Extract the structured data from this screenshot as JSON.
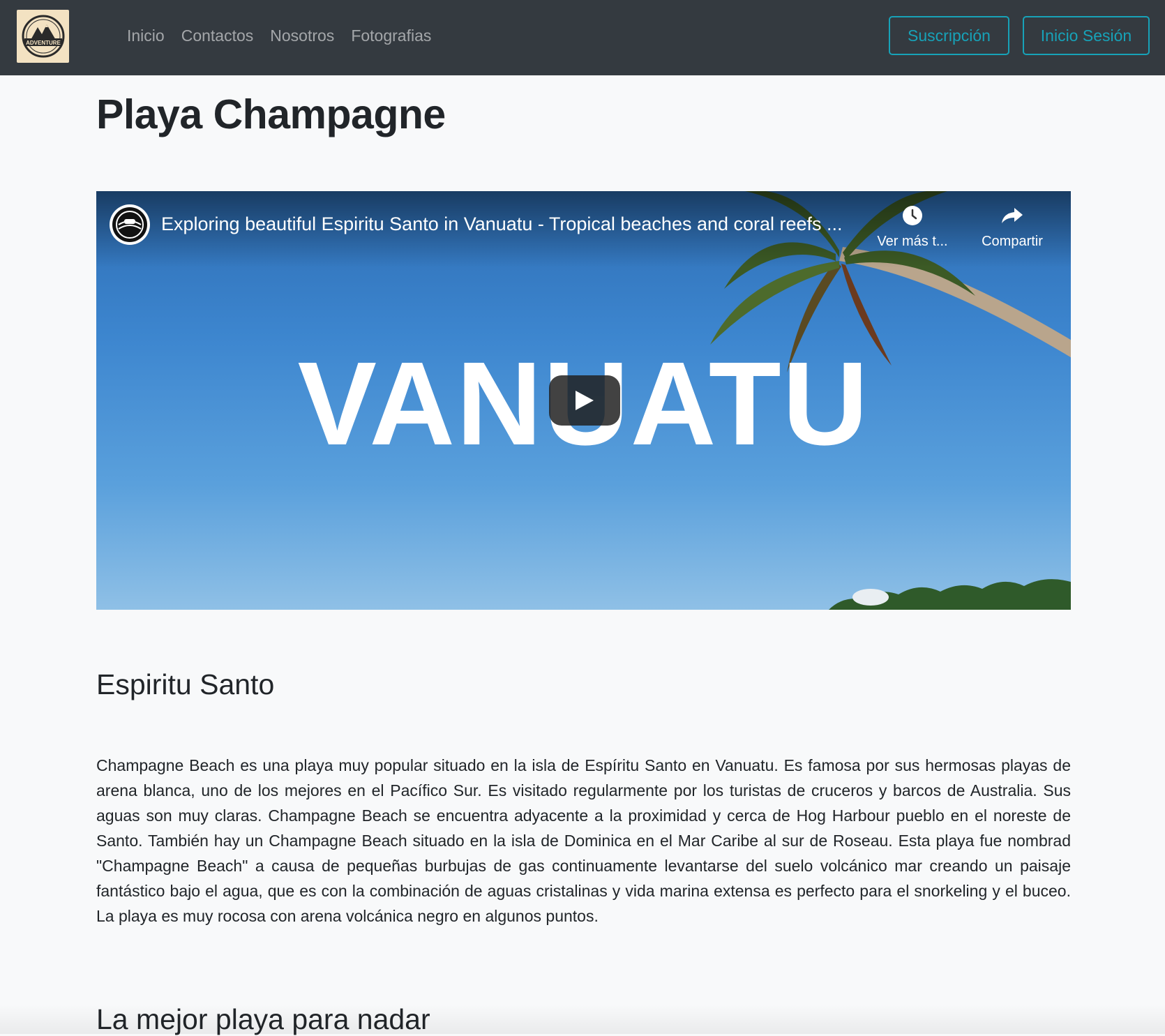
{
  "nav": {
    "brand_text": "ADVENTURE",
    "links": [
      "Inicio",
      "Contactos",
      "Nosotros",
      "Fotografias"
    ],
    "subscribe_label": "Suscripción",
    "login_label": "Inicio Sesión"
  },
  "main": {
    "title": "Playa Champagne",
    "video": {
      "title": "Exploring beautiful Espiritu Santo in Vanuatu - Tropical beaches and coral reefs ...",
      "watch_later_label": "Ver más t...",
      "share_label": "Compartir",
      "thumbnail_text": "VANUATU"
    },
    "section1_title": "Espiritu Santo",
    "section1_text": "Champagne Beach es una playa muy popular situado en la isla de Espíritu Santo en Vanuatu. Es famosa por sus hermosas playas de arena blanca, uno de los mejores en el Pacífico Sur. Es visitado regularmente por los turistas de cruceros y barcos de Australia. Sus aguas son muy claras. Champagne Beach se encuentra adyacente a la proximidad y cerca de Hog Harbour pueblo en el noreste de Santo.  También hay un Champagne Beach situado en la isla de Dominica en el Mar Caribe al sur de Roseau. Esta playa fue nombrad \"Champagne Beach\" a causa de pequeñas burbujas de gas continuamente levantarse del suelo volcánico mar creando un paisaje fantástico bajo el agua, que es con la combinación de aguas cristalinas y vida marina extensa es perfecto para el snorkeling y el buceo. La playa es muy rocosa con arena volcánica negro en algunos puntos.",
    "section2_title": "La mejor playa para nadar"
  },
  "colors": {
    "navbar_bg": "#343a40",
    "accent": "#17a2b8",
    "page_bg": "#f8f9fa"
  },
  "icons": {
    "logo": "adventure-mountain-logo",
    "channel": "channel-logo-icon",
    "watch_later": "clock-icon",
    "share": "share-arrow-icon",
    "play": "play-icon"
  }
}
